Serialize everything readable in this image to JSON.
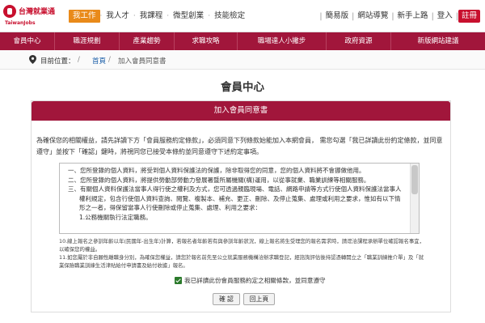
{
  "brand": {
    "title": "台灣就業通",
    "subtitle": "TaiwanJobs",
    "color": "#c8102e"
  },
  "topnav": {
    "items": [
      "我工作",
      "我人才",
      "我課程",
      "微型創業",
      "技能檢定"
    ],
    "active_index": 0,
    "active_color": "#e98a1a"
  },
  "toplinks": {
    "simple": "簡易版",
    "sitemap": "網站導覽",
    "guide": "新手上路",
    "login": "登入",
    "register": "註冊"
  },
  "mainnav": {
    "color": "#a1163b",
    "items": [
      "會員中心",
      "職涯規劃",
      "產業趨勢",
      "求職攻略",
      "職場達人小撇步",
      "政府資源",
      "新版網站建議"
    ]
  },
  "breadcrumb": {
    "label": "目前位置：",
    "home": "首頁",
    "current": "加入會員同意書"
  },
  "page": {
    "title": "會員中心",
    "panel_title": "加入會員同意書",
    "intro": "為確保您的相關權益，請先詳讀下方「會員服務約定條款」，必須同意下列條款始能加入本網會員， 需您勾選「我已詳讀此份約定條款，並同意遵守」並按下「確認」鍵時，將視同您已接受本條約並同意遵守下述約定事項。"
  },
  "terms": [
    "一、您所登錄的個人資料，將受到個人資料保護法的保護，除非取得您的同意，您的個人資料將不會挪做他用。",
    "二、您所登錄的個人資料，將提供勞動部勞動力發展署暨所屬機關(構)運用，以從事就業、職業訓練等相關服務。",
    "三、有關個人資料保護法當事人得行使之權利及方式，您可透過親臨現場、電話、網路申請等方式行使個人資料保護法當事人",
    "權利規定，包含行使個人資料查詢、閱覽、複製本、補充、更正、刪除、及停止蒐集、處理或利用之要求，惟如有以下情",
    "形之一者，得保留當事人行使刪除或停止蒐集、處理、利用之要求：",
    "1.公務機關執行法定職務。"
  ],
  "notes": [
    "10.線上報名之參訓年齡以年(民國年-出生年)計算，若報名者年齡若有與參訓年齡狀況，線上報名將生受理您的報名需求時，請逕洽課程承辦單位確認報名事宜，以確保您的權益。",
    "11.如您屬於非自願性離職身分別，為確保您權益，請您於報名前先至公立就業服務機構洽辦求職登記，經諮詢評估後持認憑轉開立之「職業訓練推介單」及「就業保險職業訓練生活津貼給付申請書及給付收據」報名。"
  ],
  "agreement": {
    "label": "我已詳讀此份會員服務約定之相關條款，並同意遵守",
    "checked": true
  },
  "buttons": {
    "confirm": "確 認",
    "back": "回上頁"
  }
}
